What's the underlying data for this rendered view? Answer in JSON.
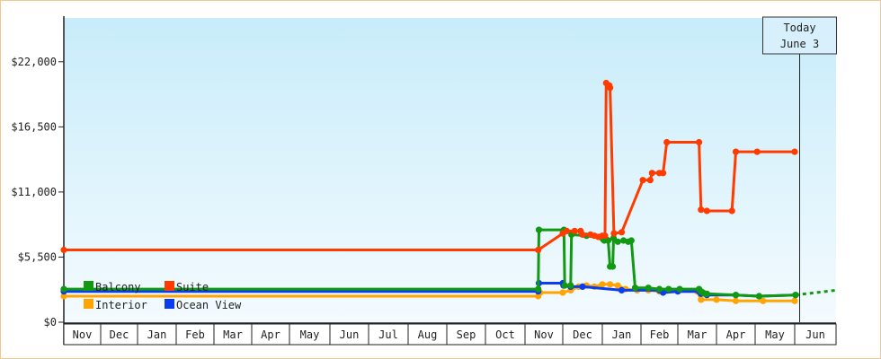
{
  "chart_data": {
    "type": "line",
    "xlabel": "",
    "ylabel": "",
    "ylim": [
      0,
      25700
    ],
    "y_ticks": [
      "$0",
      "$5,500",
      "$11,000",
      "$16,500",
      "$22,000"
    ],
    "y_tick_values": [
      0,
      5500,
      11000,
      16500,
      22000
    ],
    "x_ticks": [
      "Nov",
      "Dec",
      "Jan",
      "Feb",
      "Mar",
      "Apr",
      "May",
      "Jun",
      "Jul",
      "Aug",
      "Sep",
      "Oct",
      "Nov",
      "Dec",
      "Jan",
      "Feb",
      "Mar",
      "Apr",
      "May",
      "Jun"
    ],
    "grid": false,
    "legend_position": "bottom-left",
    "today": {
      "line1": "Today",
      "line2": "June 3",
      "x": 19.12
    },
    "series": [
      {
        "name": "Balcony",
        "color": "#119911",
        "points": [
          [
            0,
            2800
          ],
          [
            12.35,
            2800
          ],
          [
            12.37,
            7800
          ],
          [
            13.03,
            7800
          ],
          [
            13.05,
            3100
          ],
          [
            13.2,
            3100
          ],
          [
            13.22,
            7400
          ],
          [
            13.6,
            7300
          ],
          [
            14.0,
            7100
          ],
          [
            14.02,
            7000
          ],
          [
            14.05,
            6900
          ],
          [
            14.1,
            7000
          ],
          [
            14.15,
            6900
          ],
          [
            14.2,
            4700
          ],
          [
            14.27,
            4700
          ],
          [
            14.29,
            7100
          ],
          [
            14.4,
            6800
          ],
          [
            14.55,
            6900
          ],
          [
            14.67,
            6800
          ],
          [
            14.75,
            6900
          ],
          [
            14.85,
            2900
          ],
          [
            15.2,
            2900
          ],
          [
            15.5,
            2800
          ],
          [
            15.75,
            2800
          ],
          [
            16.05,
            2800
          ],
          [
            16.55,
            2800
          ],
          [
            16.6,
            2600
          ],
          [
            16.65,
            2500
          ],
          [
            16.7,
            2400
          ],
          [
            16.75,
            2400
          ],
          [
            17.5,
            2300
          ],
          [
            18.1,
            2200
          ],
          [
            19.02,
            2300
          ]
        ]
      },
      {
        "name": "Suite",
        "color": "#ff3b00",
        "points": [
          [
            0,
            6100
          ],
          [
            12.35,
            6100
          ],
          [
            13.0,
            7500
          ],
          [
            13.1,
            7700
          ],
          [
            13.3,
            7700
          ],
          [
            13.45,
            7700
          ],
          [
            13.5,
            7400
          ],
          [
            13.7,
            7400
          ],
          [
            13.8,
            7300
          ],
          [
            13.9,
            7200
          ],
          [
            14.0,
            7300
          ],
          [
            14.07,
            7300
          ],
          [
            14.1,
            20200
          ],
          [
            14.18,
            20000
          ],
          [
            14.2,
            19800
          ],
          [
            14.3,
            7500
          ],
          [
            14.5,
            7600
          ],
          [
            15.05,
            12000
          ],
          [
            15.25,
            12000
          ],
          [
            15.3,
            12600
          ],
          [
            15.5,
            12600
          ],
          [
            15.6,
            12600
          ],
          [
            15.7,
            15200
          ],
          [
            16.55,
            15200
          ],
          [
            16.6,
            9500
          ],
          [
            16.75,
            9400
          ],
          [
            17.4,
            9400
          ],
          [
            17.5,
            14400
          ],
          [
            18.05,
            14400
          ],
          [
            19.0,
            14400
          ]
        ]
      },
      {
        "name": "Interior",
        "color": "#ffa400",
        "points": [
          [
            0,
            2200
          ],
          [
            12.35,
            2200
          ],
          [
            12.4,
            2500
          ],
          [
            13.0,
            2500
          ],
          [
            13.2,
            2700
          ],
          [
            13.4,
            3000
          ],
          [
            13.6,
            3100
          ],
          [
            13.8,
            3000
          ],
          [
            14.0,
            3200
          ],
          [
            14.2,
            3200
          ],
          [
            14.4,
            3100
          ],
          [
            14.6,
            2800
          ],
          [
            14.9,
            2700
          ],
          [
            15.2,
            2700
          ],
          [
            15.5,
            2600
          ],
          [
            16.5,
            2600
          ],
          [
            16.6,
            1900
          ],
          [
            17.0,
            1900
          ],
          [
            17.5,
            1800
          ],
          [
            18.2,
            1800
          ],
          [
            19.0,
            1800
          ]
        ]
      },
      {
        "name": "Ocean View",
        "color": "#0a3cf0",
        "points": [
          [
            0,
            2600
          ],
          [
            12.35,
            2600
          ],
          [
            12.37,
            3300
          ],
          [
            13.0,
            3300
          ],
          [
            13.02,
            3100
          ],
          [
            13.2,
            3000
          ],
          [
            13.5,
            3000
          ],
          [
            14.5,
            2700
          ],
          [
            15.5,
            2700
          ],
          [
            15.6,
            2500
          ],
          [
            16.0,
            2600
          ],
          [
            16.55,
            2600
          ],
          [
            16.6,
            2400
          ],
          [
            16.75,
            2300
          ],
          [
            17.5,
            2300
          ],
          [
            18.1,
            2200
          ],
          [
            19.02,
            2300
          ]
        ]
      }
    ],
    "projection": {
      "series": "Balcony",
      "points": [
        [
          19.02,
          2300
        ],
        [
          20.0,
          2700
        ]
      ]
    }
  }
}
